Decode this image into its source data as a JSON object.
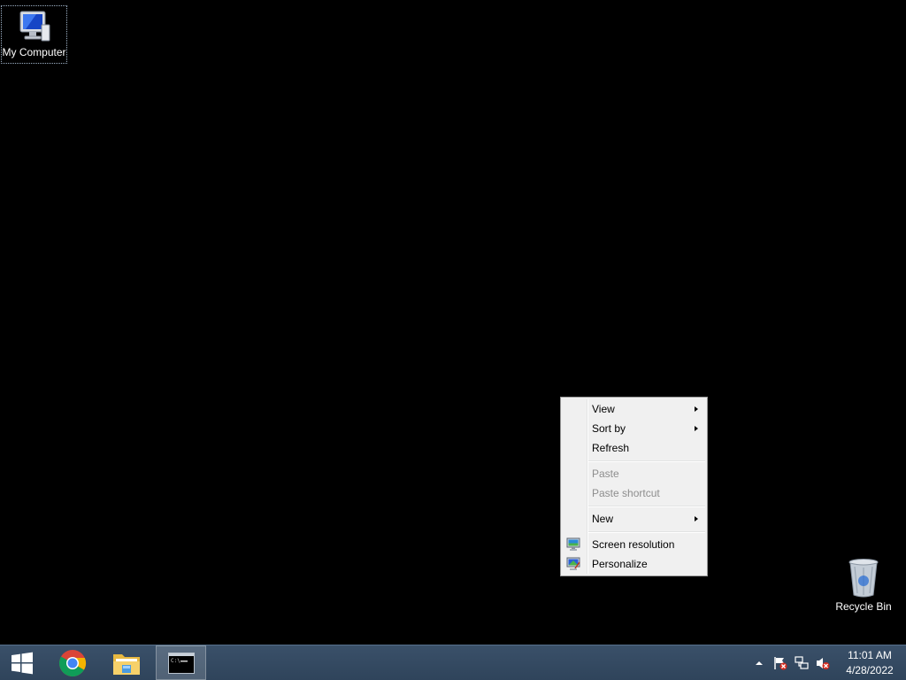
{
  "desktop": {
    "icons": [
      {
        "label": "My Computer",
        "icon": "computer-icon"
      },
      {
        "label": "Recycle Bin",
        "icon": "recycle-bin-icon"
      }
    ]
  },
  "context_menu": {
    "items": {
      "view": {
        "label": "View",
        "submenu": true
      },
      "sort_by": {
        "label": "Sort by",
        "submenu": true
      },
      "refresh": {
        "label": "Refresh"
      },
      "paste": {
        "label": "Paste",
        "disabled": true
      },
      "paste_shortcut": {
        "label": "Paste shortcut",
        "disabled": true
      },
      "new": {
        "label": "New",
        "submenu": true
      },
      "screen_resolution": {
        "label": "Screen resolution",
        "icon": "display-icon"
      },
      "personalize": {
        "label": "Personalize",
        "icon": "personalize-icon"
      }
    }
  },
  "taskbar": {
    "pinned": [
      {
        "name": "start",
        "icon": "windows-logo-icon"
      },
      {
        "name": "chrome",
        "icon": "chrome-icon"
      },
      {
        "name": "file-explorer",
        "icon": "folder-icon"
      },
      {
        "name": "command-prompt",
        "icon": "cmd-icon",
        "active": true
      }
    ],
    "tray": {
      "icons": [
        "show-hidden-icons-icon",
        "action-center-flag-icon",
        "network-icon",
        "volume-muted-icon"
      ],
      "time": "11:01 AM",
      "date": "4/28/2022"
    }
  },
  "colors": {
    "desktop_background": "#000000",
    "taskbar": "#34495f",
    "menu_background": "#f0f0f0",
    "disabled_text": "#8d8d8d"
  }
}
